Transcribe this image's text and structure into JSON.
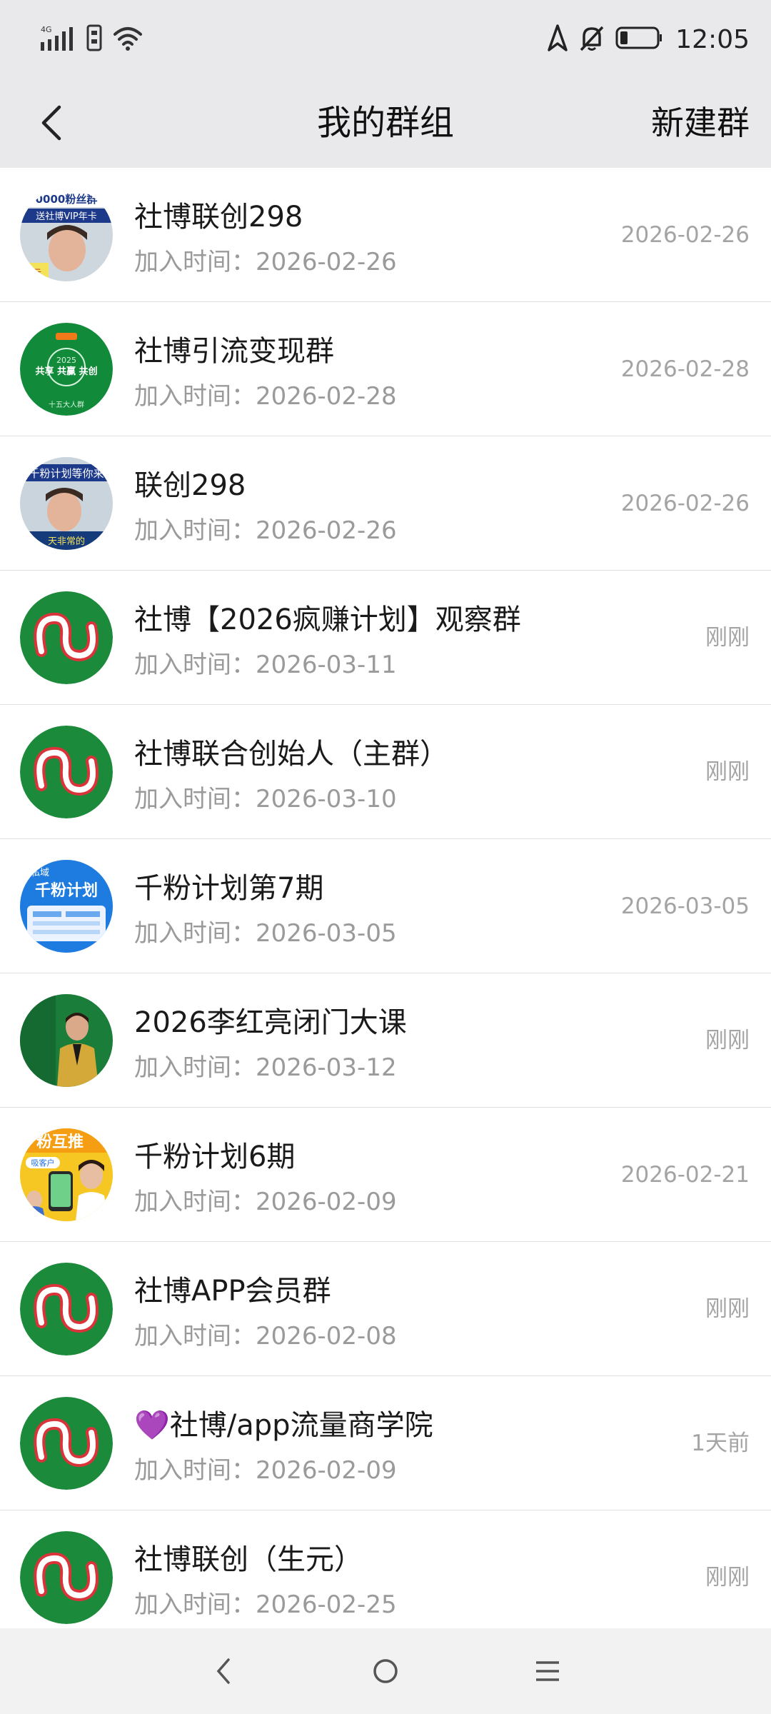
{
  "status_bar": {
    "network": "4G",
    "time": "12:05"
  },
  "header": {
    "title": "我的群组",
    "new_group": "新建群"
  },
  "join_prefix": "加入时间：",
  "groups": [
    {
      "name": "社博联创298",
      "join_date": "2026-02-26",
      "time": "2026-02-26",
      "avatar": "photo-woman-banner",
      "avatar_text_top": "0000粉丝群",
      "avatar_text_2": "送社博VIP年卡",
      "avatar_text_3": "生元"
    },
    {
      "name": "社博引流变现群",
      "join_date": "2026-02-28",
      "time": "2026-02-28",
      "avatar": "green-badge",
      "avatar_text_top": "共享 共赢 共创",
      "avatar_text_2": "2025",
      "avatar_text_3": "十五大人群"
    },
    {
      "name": "联创298",
      "join_date": "2026-02-26",
      "time": "2026-02-26",
      "avatar": "photo-woman-banner2",
      "avatar_text_top": "千粉计划等你来",
      "avatar_text_2": "天非常的"
    },
    {
      "name": "社博【2026疯赚计划】观察群",
      "join_date": "2026-03-11",
      "time": "刚刚",
      "avatar": "logo"
    },
    {
      "name": "社博联合创始人（主群）",
      "join_date": "2026-03-10",
      "time": "刚刚",
      "avatar": "logo"
    },
    {
      "name": "千粉计划第7期",
      "join_date": "2026-03-05",
      "time": "2026-03-05",
      "avatar": "blue-poster",
      "avatar_text_top": "私域",
      "avatar_text_2": "千粉计划"
    },
    {
      "name": "2026李红亮闭门大课",
      "join_date": "2026-03-12",
      "time": "刚刚",
      "avatar": "green-man"
    },
    {
      "name": "千粉计划6期",
      "join_date": "2026-02-09",
      "time": "2026-02-21",
      "avatar": "yellow-poster",
      "avatar_text_top": "粉互推",
      "avatar_text_2": "吸客户"
    },
    {
      "name": "社博APP会员群",
      "join_date": "2026-02-08",
      "time": "刚刚",
      "avatar": "logo"
    },
    {
      "name": "💜社博/app流量商学院",
      "join_date": "2026-02-09",
      "time": "1天前",
      "avatar": "logo"
    },
    {
      "name": "社博联创（生元）",
      "join_date": "2026-02-25",
      "time": "刚刚",
      "avatar": "logo"
    }
  ],
  "nav": {
    "back": "back",
    "home": "home",
    "menu": "menu"
  },
  "colors": {
    "header_bg": "#e9e9eb",
    "logo_green": "#1b8a3b",
    "logo_red": "#d9343a",
    "muted": "#9a9a9a"
  }
}
